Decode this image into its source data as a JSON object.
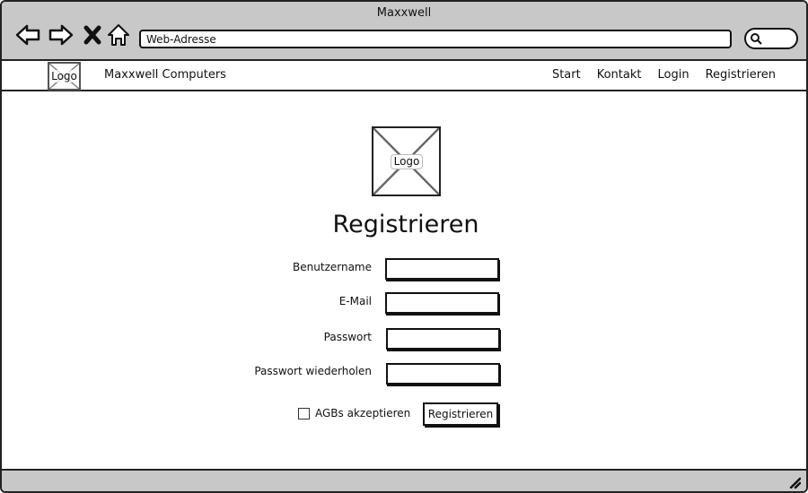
{
  "window": {
    "title": "Maxxwell"
  },
  "browser": {
    "back_icon": "arrow-left-icon",
    "forward_icon": "arrow-right-icon",
    "stop_icon": "close-icon",
    "home_icon": "home-icon",
    "url": "Web-Adresse",
    "search_icon": "search-icon"
  },
  "site_nav": {
    "logo_label": "Logo",
    "brand": "Maxxwell Computers",
    "links": [
      "Start",
      "Kontakt",
      "Login",
      "Registrieren"
    ]
  },
  "main": {
    "logo_label": "Logo",
    "title": "Registrieren",
    "fields": [
      {
        "label": "Benutzername",
        "value": ""
      },
      {
        "label": "E-Mail",
        "value": ""
      },
      {
        "label": "Passwort",
        "value": ""
      },
      {
        "label": "Passwort wiederholen",
        "value": ""
      }
    ],
    "checkbox_label": "AGBs akzeptieren",
    "checkbox_checked": false,
    "submit_label": "Registrieren"
  },
  "colors": {
    "chrome": "#c8c8c8",
    "border": "#222222",
    "background": "#ffffff"
  }
}
